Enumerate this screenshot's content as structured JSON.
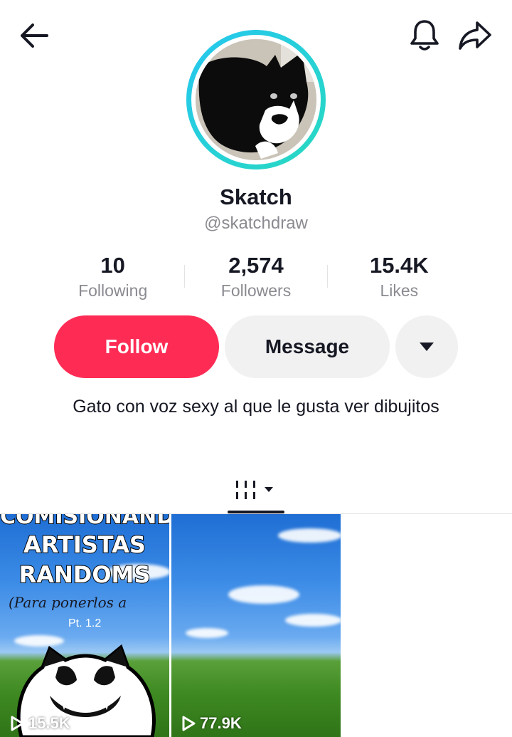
{
  "header": {
    "back_icon": "arrow-left-icon",
    "bell_icon": "bell-icon",
    "share_icon": "share-arrow-icon"
  },
  "profile": {
    "name": "Skatch",
    "handle": "@skatchdraw",
    "ring_colors": [
      "#25c7f0",
      "#28d9c0"
    ]
  },
  "stats": [
    {
      "value": "10",
      "label": "Following"
    },
    {
      "value": "2,574",
      "label": "Followers"
    },
    {
      "value": "15.4K",
      "label": "Likes"
    }
  ],
  "actions": {
    "follow_label": "Follow",
    "message_label": "Message",
    "more_icon": "caret-down-icon",
    "follow_color": "#fe2c55"
  },
  "bio": "Gato con voz sexy al que le gusta ver dibujitos",
  "tabs": {
    "videos_icon": "grid-columns-icon"
  },
  "videos": [
    {
      "overlay_top": "COMISIONANDO",
      "overlay_line1": "ARTISTAS",
      "overlay_line2": "RANDOMS",
      "overlay_sub": "(Para ponerlos a",
      "overlay_pt": "Pt. 1.2",
      "views": "15.5K"
    },
    {
      "views": "77.9K"
    }
  ]
}
